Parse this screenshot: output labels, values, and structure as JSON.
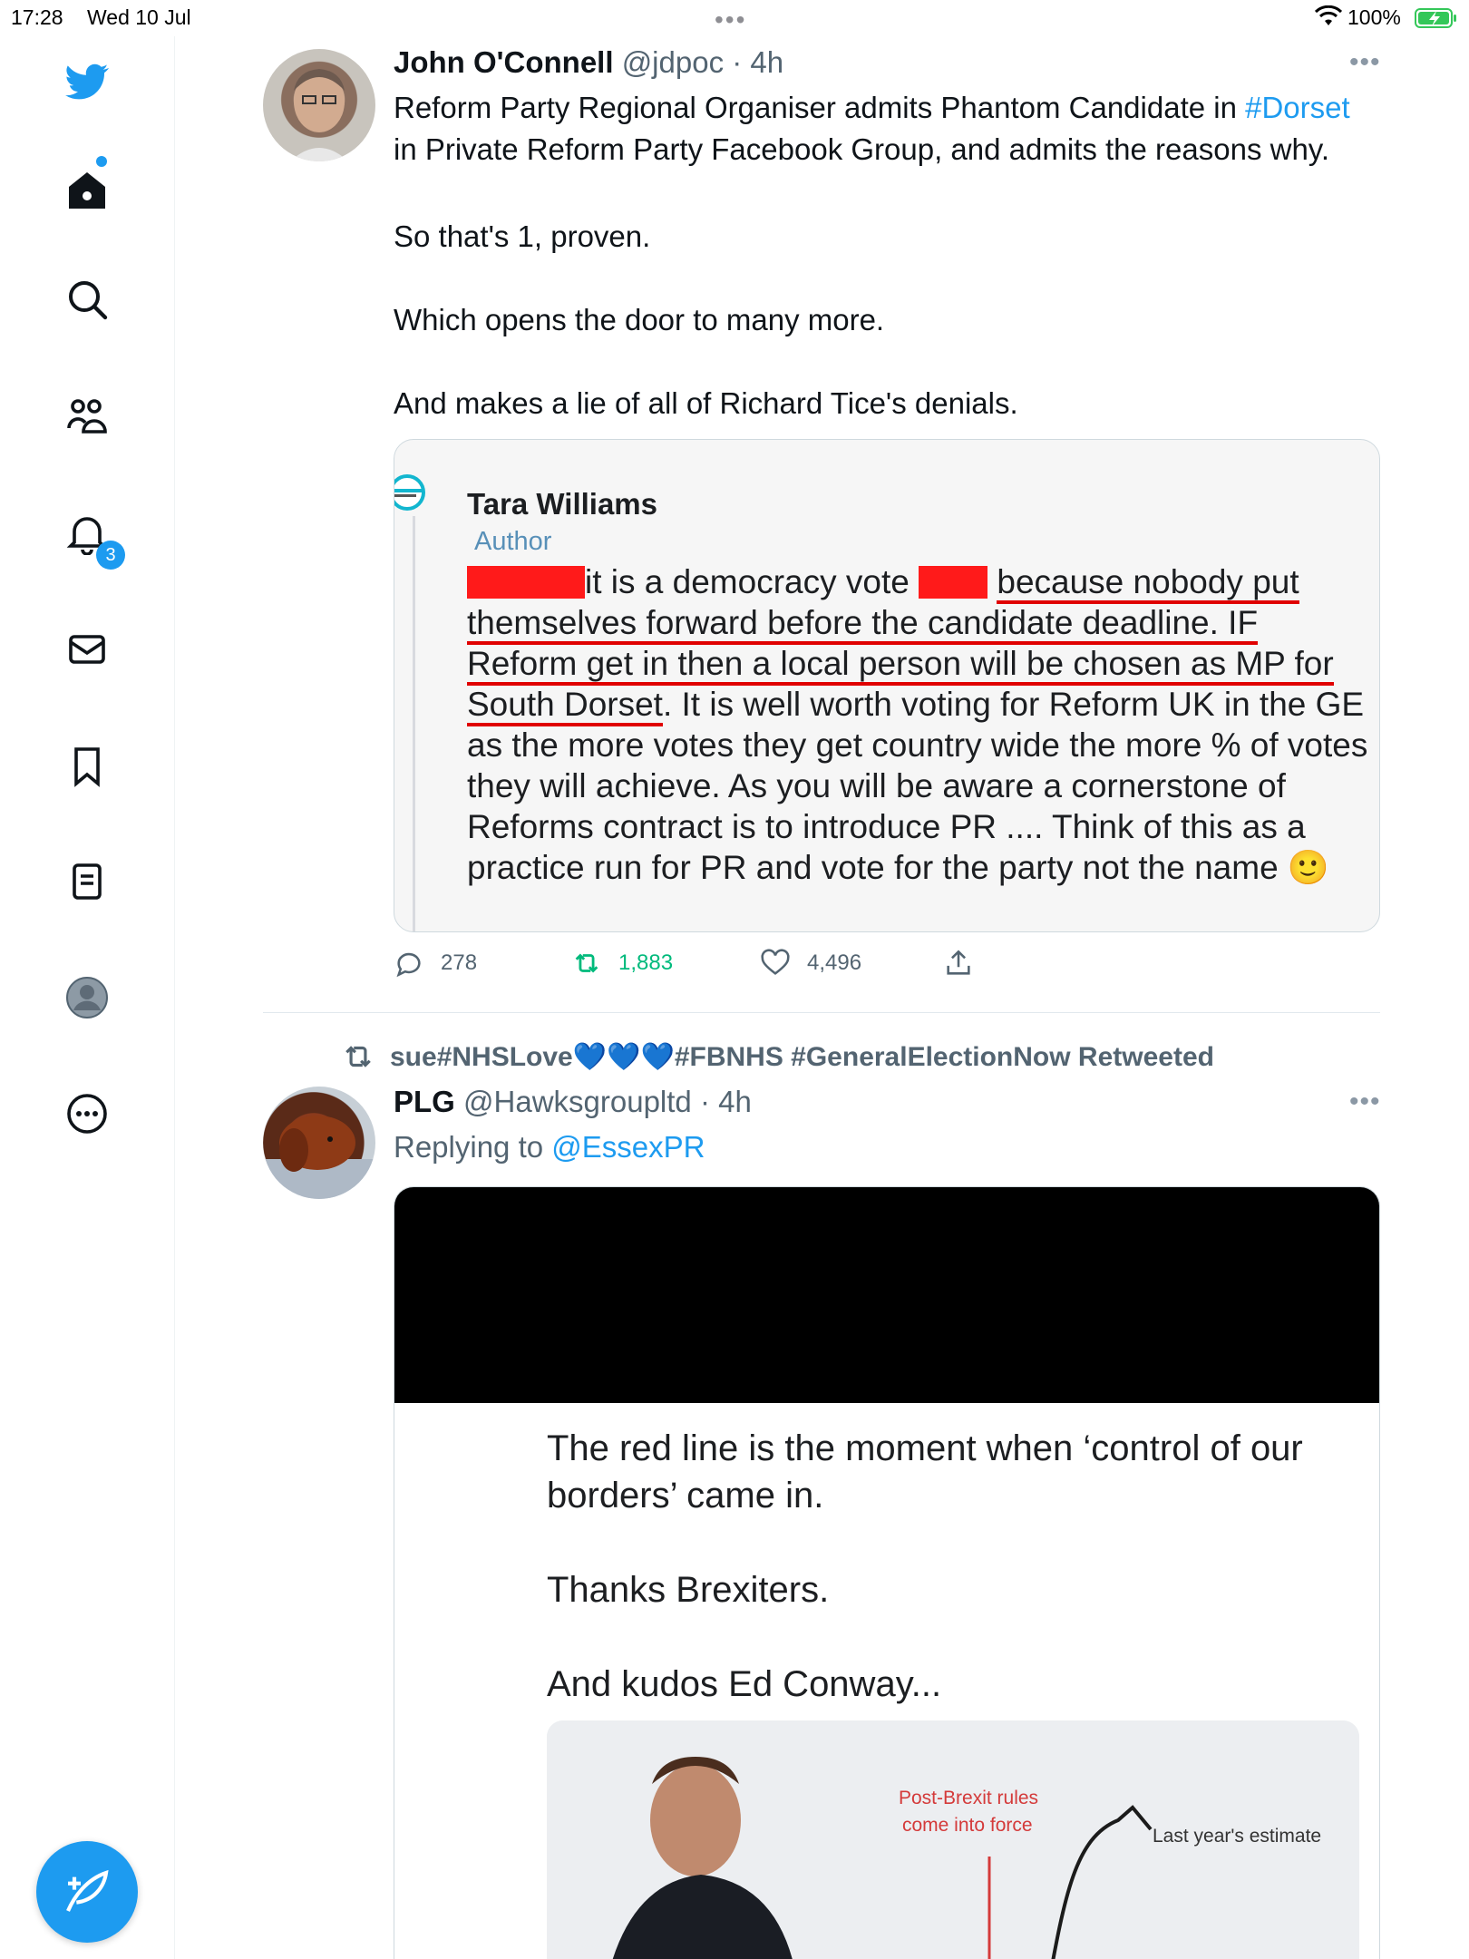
{
  "status_bar": {
    "time": "17:28",
    "date": "Wed 10 Jul",
    "battery": "100%"
  },
  "sidebar": {
    "items": [
      {
        "name": "home"
      },
      {
        "name": "search"
      },
      {
        "name": "communities"
      },
      {
        "name": "notifications",
        "badge": "3"
      },
      {
        "name": "messages"
      },
      {
        "name": "bookmarks"
      },
      {
        "name": "lists"
      },
      {
        "name": "profile"
      },
      {
        "name": "more"
      }
    ]
  },
  "tweet1": {
    "name": "John O'Connell",
    "handle": "@jdpoc · 4h",
    "text_line1": "Reform Party Regional Organiser admits Phantom Candidate in ",
    "hashtag": "#Dorset",
    "text_line2": "in Private Reform Party Facebook Group, and admits the reasons why.",
    "p2": "So that's 1, proven.",
    "p3": "Which opens the door to many more.",
    "p4": "And makes a lie of all of Richard Tice's denials.",
    "media": {
      "author": "Tara Williams",
      "role": "Author",
      "seg1": "it is a democracy vote ",
      "seg2": "because nobody put",
      "seg3": "themselves forward before the candidate deadline. IF",
      "seg4": "Reform get in then a local person will be chosen as MP for",
      "seg5": "South Dorset",
      "seg6": ". It is well worth voting for Reform UK in the GE as the more votes they get country wide the more % of votes they will achieve. As you will be aware a cornerstone of Reforms contract is to introduce PR .... Think of this as a practice run for PR and vote for the party not the name 🙂"
    },
    "replies": "278",
    "retweets": "1,883",
    "likes": "4,496",
    "retweet_color": "#00ba7c"
  },
  "tweet2": {
    "retweeted_by": "sue#NHSLove",
    "hearts": "💙💙💙",
    "retweeted_suffix": "#FBNHS #GeneralElectionNow Retweeted",
    "name": "PLG",
    "handle": "@Hawksgroupltd · 4h",
    "replying_prefix": "Replying to ",
    "replying_to": "@EssexPR",
    "media": {
      "quote": "The red line is the moment when ‘control of our borders’ came in.\n\nThanks Brexiters.\n\nAnd kudos Ed Conway...",
      "chart_label1": "Post-Brexit rules",
      "chart_label2": "come into force",
      "chart_label3": "Last year's estimate"
    }
  },
  "colors": {
    "accent": "#1d9bf0",
    "text": "#0f1419",
    "muted": "#536471"
  }
}
